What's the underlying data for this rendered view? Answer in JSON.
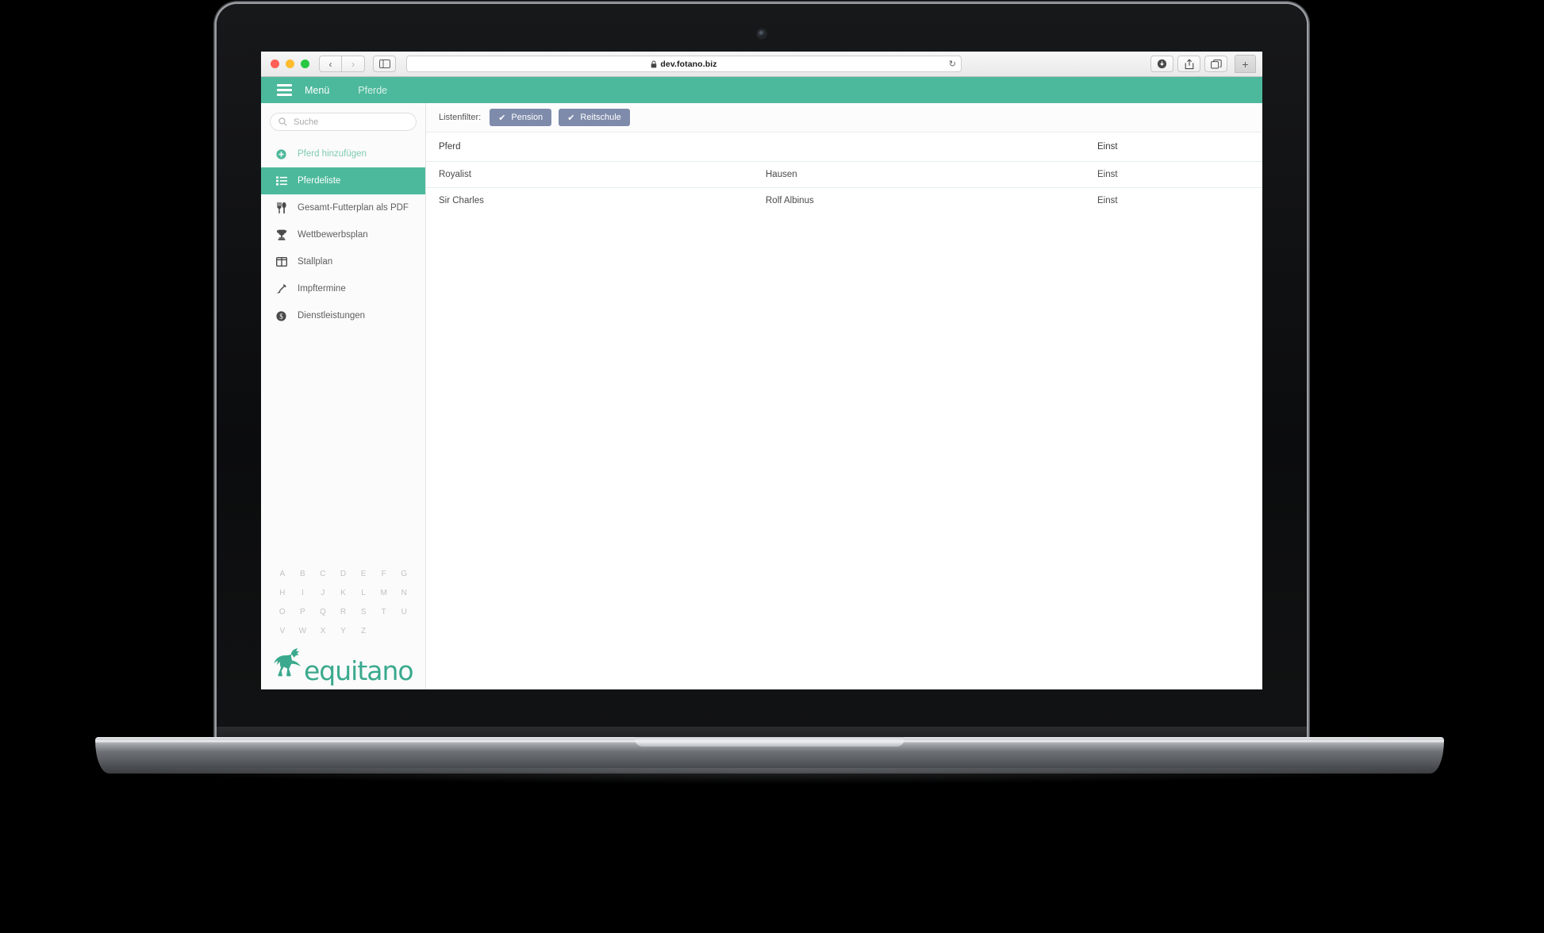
{
  "browser": {
    "url": "dev.fotano.biz",
    "lock_icon": "lock-icon",
    "back_glyph": "‹",
    "forward_glyph": "›",
    "sidebar_toggle_icon": "sidebar-toggle-icon",
    "reload_glyph": "↻",
    "download_icon": "download-icon",
    "share_icon": "share-icon",
    "tab_overview_icon": "tab-overview-icon",
    "new_tab_glyph": "+"
  },
  "header": {
    "menu_label": "Menü",
    "breadcrumb": "Pferde",
    "background_color": "#4db99c"
  },
  "sidebar": {
    "search": {
      "placeholder": "Suche",
      "icon": "search-icon"
    },
    "items": [
      {
        "label": "Pferd hinzufügen",
        "icon": "plus-circle-icon",
        "active": false,
        "style": "add"
      },
      {
        "label": "Pferdeliste",
        "icon": "list-icon",
        "active": true,
        "style": "normal"
      },
      {
        "label": "Gesamt-Futterplan als PDF",
        "icon": "cutlery-icon",
        "active": false,
        "style": "normal"
      },
      {
        "label": "Wettbewerbsplan",
        "icon": "trophy-icon",
        "active": false,
        "style": "normal"
      },
      {
        "label": "Stallplan",
        "icon": "columns-icon",
        "active": false,
        "style": "normal"
      },
      {
        "label": "Impftermine",
        "icon": "syringe-icon",
        "active": false,
        "style": "normal"
      },
      {
        "label": "Dienstleistungen",
        "icon": "money-circle-icon",
        "active": false,
        "style": "normal"
      }
    ],
    "alphabet_index": [
      "A",
      "B",
      "C",
      "D",
      "E",
      "F",
      "G",
      "H",
      "I",
      "J",
      "K",
      "L",
      "M",
      "N",
      "O",
      "P",
      "Q",
      "R",
      "S",
      "T",
      "U",
      "V",
      "W",
      "X",
      "Y",
      "Z"
    ],
    "brand": {
      "wordmark": "equitano",
      "logo_icon": "pegasus-icon",
      "color": "#3aa98d"
    }
  },
  "main": {
    "filter_bar": {
      "label": "Listenfilter:",
      "chips": [
        {
          "label": "Pension",
          "checked": true,
          "check_glyph": "✔"
        },
        {
          "label": "Reitschule",
          "checked": true,
          "check_glyph": "✔"
        }
      ],
      "chip_color": "#7e8bab"
    },
    "table": {
      "columns": [
        "Pferd",
        "",
        "Einst"
      ],
      "rows": [
        {
          "name": "Royalist",
          "owner": "Hausen",
          "settings": "Einst"
        },
        {
          "name": "Sir Charles",
          "owner": "Rolf Albinus",
          "settings": "Einst"
        }
      ]
    }
  }
}
